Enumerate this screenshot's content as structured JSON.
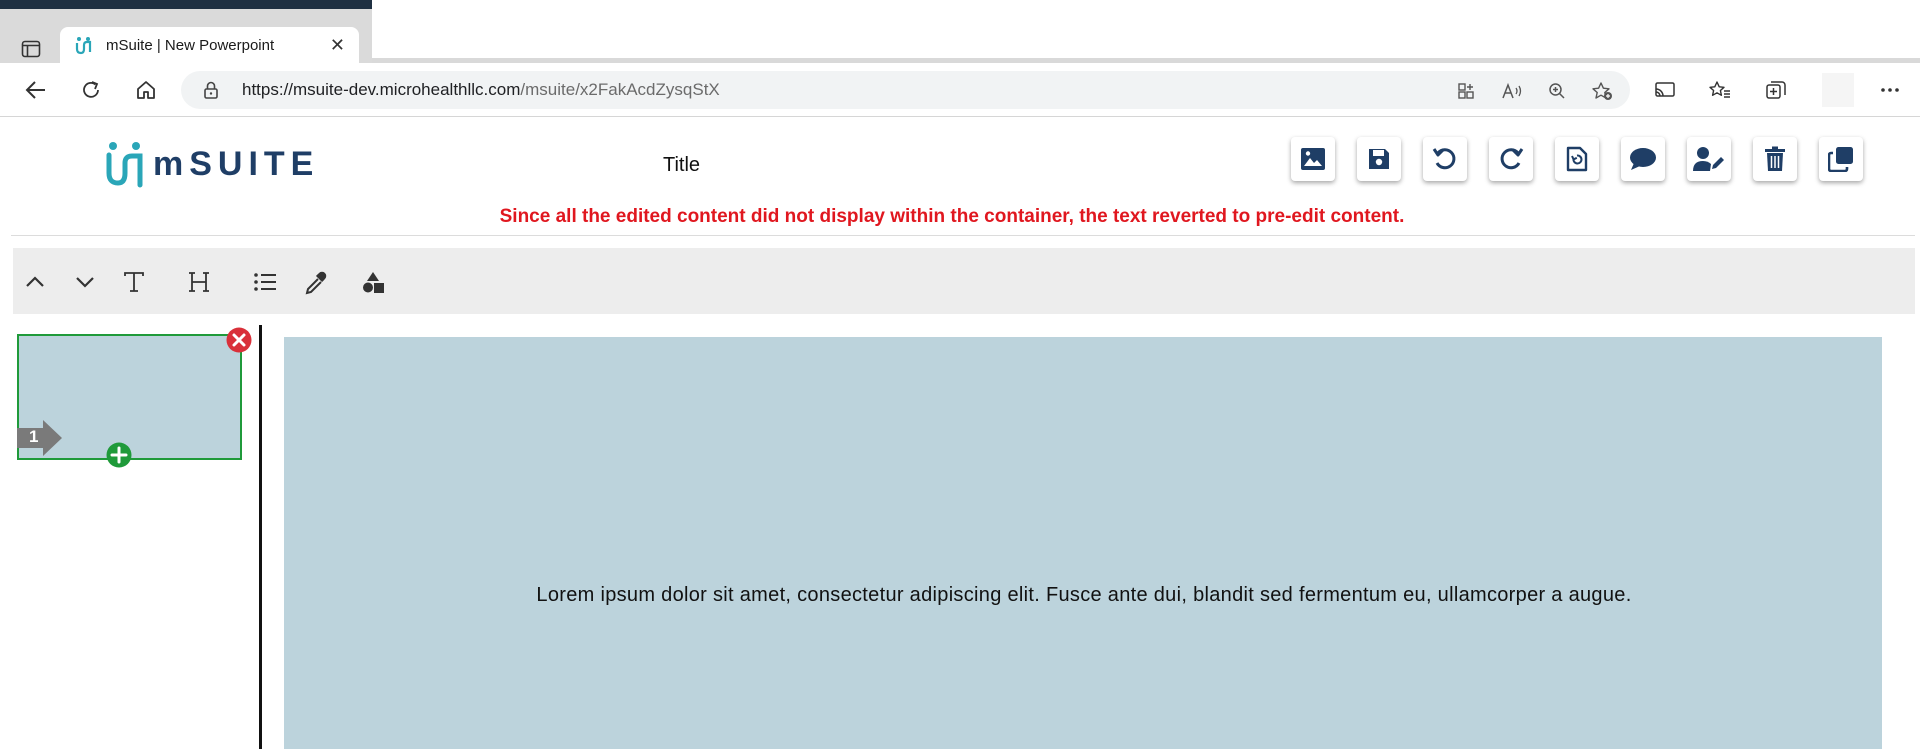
{
  "browser": {
    "tab_title": "mSuite | New Powerpoint",
    "url_host": "https://msuite-dev.microhealthllc.com",
    "url_path": "/msuite/x2FakAcdZysqStX"
  },
  "app": {
    "logo_text": "mSUITE",
    "document_title": "Title",
    "warning_message": "Since all the edited content did not display within the container, the text reverted to pre-edit content.",
    "accent_color": "#1f3e66",
    "warning_color": "#e0171f"
  },
  "actions": [
    {
      "name": "insert-image-button",
      "icon": "image-icon"
    },
    {
      "name": "save-button",
      "icon": "floppy-disk-icon"
    },
    {
      "name": "undo-button",
      "icon": "undo-icon"
    },
    {
      "name": "redo-button",
      "icon": "redo-icon"
    },
    {
      "name": "revert-file-button",
      "icon": "file-revert-icon"
    },
    {
      "name": "comments-button",
      "icon": "comment-icon"
    },
    {
      "name": "edit-user-button",
      "icon": "user-edit-icon"
    },
    {
      "name": "delete-button",
      "icon": "trash-icon"
    },
    {
      "name": "duplicate-button",
      "icon": "copy-icon"
    }
  ],
  "editor_tools": [
    {
      "name": "move-up-button",
      "icon": "chevron-up-icon"
    },
    {
      "name": "move-down-button",
      "icon": "chevron-down-icon"
    },
    {
      "name": "text-tool-button",
      "icon": "text-t-icon",
      "glyph": "T"
    },
    {
      "name": "heading-tool-button",
      "icon": "heading-h-icon",
      "glyph": "H"
    },
    {
      "name": "list-tool-button",
      "icon": "list-icon"
    },
    {
      "name": "eyedropper-tool-button",
      "icon": "eyedropper-icon"
    },
    {
      "name": "shapes-tool-button",
      "icon": "shapes-icon"
    }
  ],
  "slides": [
    {
      "number": "1",
      "background": "#bcd3dc"
    }
  ],
  "canvas": {
    "body_text": "Lorem ipsum dolor sit amet, consectetur adipiscing elit. Fusce ante dui, blandit sed fermentum eu, ullamcorper a augue.",
    "background": "#bcd3dc"
  }
}
